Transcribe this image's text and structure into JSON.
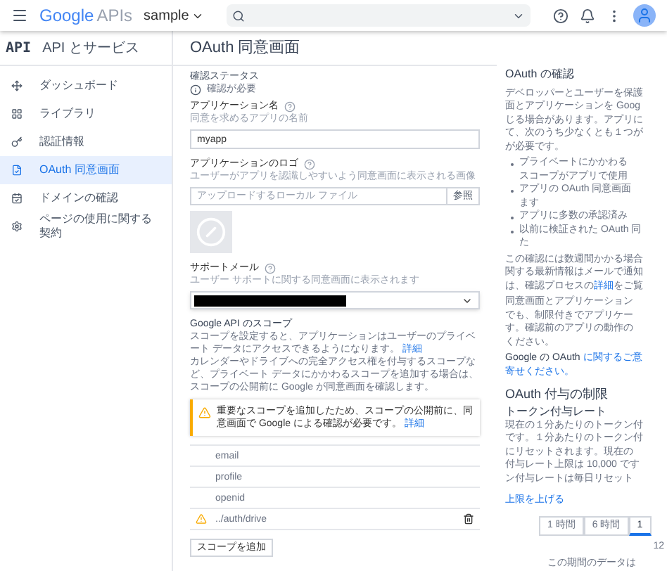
{
  "header": {
    "brand": "Google",
    "product": "APIs",
    "project": "sample"
  },
  "sidebar": {
    "badge": "API",
    "title": "API とサービス",
    "items": [
      {
        "label": "ダッシュボード",
        "selected": false
      },
      {
        "label": "ライブラリ",
        "selected": false
      },
      {
        "label": "認証情報",
        "selected": false
      },
      {
        "label": "OAuth 同意画面",
        "selected": true
      },
      {
        "label": "ドメインの確認",
        "selected": false
      },
      {
        "label": "ページの使用に関する契約",
        "selected": false
      }
    ]
  },
  "page_title": "OAuth 同意画面",
  "form": {
    "status_label": "確認ステータス",
    "status": "確認が必要",
    "app_name": {
      "label": "アプリケーション名",
      "hint": "同意を求めるアプリの名前",
      "value": "myapp"
    },
    "logo": {
      "label": "アプリケーションのロゴ",
      "hint": "ユーザーがアプリを認識しやすいよう同意画面に表示される画像",
      "placeholder": "アップロードするローカル ファイル",
      "button": "参照"
    },
    "support_email": {
      "label": "サポートメール",
      "hint": "ユーザー サポートに関する同意画面に表示されます"
    },
    "scopes": {
      "title": "Google API のスコープ",
      "desc1": "スコープを設定すると、アプリケーションはユーザーのプライベート データにアクセスできるようになります。",
      "desc1_link": "詳細",
      "desc2": "カレンダーやドライブへの完全アクセス権を付与するスコープなど、プライベート データにかかわるスコープを追加する場合は、スコープの公開前に Google が同意画面を確認します。",
      "warning": "重要なスコープを追加したため、スコープの公開前に、同意画面で Google による確認が必要です。",
      "warning_link": "詳細",
      "rows": [
        {
          "name": "email",
          "warning": false,
          "deletable": false
        },
        {
          "name": "profile",
          "warning": false,
          "deletable": false
        },
        {
          "name": "openid",
          "warning": false,
          "deletable": false
        },
        {
          "name": "../auth/drive",
          "warning": true,
          "deletable": true
        }
      ],
      "add_button": "スコープを追加"
    }
  },
  "aside": {
    "title": "OAuth の確認",
    "para1": [
      "デベロッパーとユーザーを保護",
      "面とアプリケーションを Goog",
      "じる場合があります。アプリに",
      "て、次のうち少なくとも１つが",
      "が必要です。"
    ],
    "bullets": [
      [
        "プライベートにかかわる",
        "スコープがアプリで使用"
      ],
      [
        "アプリの OAuth 同意画面",
        "ます"
      ],
      [
        "アプリに多数の承認済み"
      ],
      [
        "以前に検証された OAuth 同",
        "た"
      ]
    ],
    "para2": [
      "この確認には数週間かかる場合",
      "関する最新情報はメールで通知"
    ],
    "para2_prefix": "は、確認プロセスの",
    "para2_link": "詳細",
    "para2_suffix": "をご覧",
    "para3": [
      "同意画面とアプリケーション",
      "でも、制限付きでアプリケー",
      "す。確認前のアプリの動作の",
      "ください。"
    ],
    "feedback_prefix": "Google の OAuth ",
    "feedback_link": "に関するご意",
    "feedback_end": "寄せください。",
    "limits_title": "OAuth 付与の制限",
    "rate_title": "トークン付与レート",
    "rate_text": [
      "現在の１分あたりのトークン付",
      "です。１分あたりのトークン付",
      "にリセットされます。現在の",
      "付与レート上限は 10,000 です",
      "ン付与レートは毎日リセット"
    ],
    "raise_link": "上限を上げる",
    "ranges": [
      {
        "label": "1 時間",
        "selected": false
      },
      {
        "label": "6 時間",
        "selected": false
      },
      {
        "label": "1",
        "selected": true
      }
    ],
    "axis_label": "12",
    "empty": "この期間のデータは"
  }
}
